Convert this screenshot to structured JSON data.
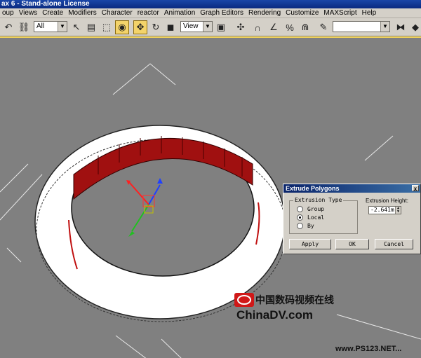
{
  "window": {
    "title": "ax 6 - Stand-alone License"
  },
  "menu": [
    "oup",
    "Views",
    "Create",
    "Modifiers",
    "Character",
    "reactor",
    "Animation",
    "Graph Editors",
    "Rendering",
    "Customize",
    "MAXScript",
    "Help"
  ],
  "toolbar": {
    "selection_filter": "All",
    "reference_coord": "View",
    "named_selection": "",
    "icons": [
      "undo-icon",
      "link-icon",
      "select-arrow-icon",
      "select-by-name-icon",
      "region-select-icon",
      "window-crossing-icon",
      "move-icon",
      "rotate-icon",
      "scale-icon",
      "pivot-icon",
      "manipulate-icon",
      "snap-3d-icon",
      "angle-snap-icon",
      "percent-snap-icon",
      "spinner-snap-icon",
      "edit-named-selection-icon",
      "mirror-icon",
      "align-icon"
    ]
  },
  "dialog": {
    "title": "Extrude Polygons",
    "close": "x",
    "group_label": "Extrusion Type",
    "options": [
      "Group",
      "Local",
      "By"
    ],
    "selected": "Local",
    "height_label": "Extrusion Height:",
    "height_value": "-2.641m",
    "apply": "Apply",
    "ok": "OK",
    "cancel": "Cancel"
  },
  "watermark": {
    "cn": "中国数码视频在线",
    "en": "ChinaDV.com",
    "url": "www.PS123.NET..."
  },
  "colors": {
    "accent": "#f1d35a",
    "viewport": "#808080",
    "ring": "#ffffff",
    "inner_face": "#a01010"
  }
}
